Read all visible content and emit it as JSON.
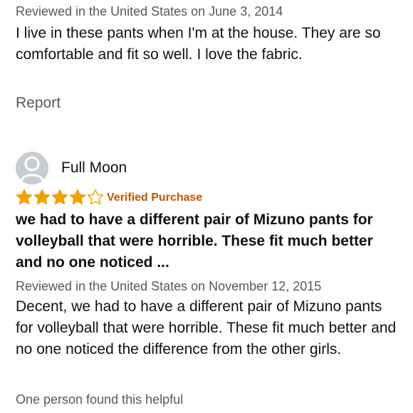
{
  "review1": {
    "meta": "Reviewed in the United States on June 3, 2014",
    "body": "I live in these pants when I'm at the house. They are so comfortable and fit so well. I love the fabric.",
    "report_label": "Report"
  },
  "review2": {
    "author": "Full Moon",
    "avatar_icon": "user-silhouette-icon",
    "rating": 4,
    "rating_max": 5,
    "star_color": "#f0a000",
    "verified_label": "Verified Purchase",
    "title": "we had to have a different pair of Mizuno pants for volleyball that were horrible. These fit much better and no one noticed ...",
    "meta": "Reviewed in the United States on November 12, 2015",
    "body": "Decent, we had to have a different pair of Mizuno pants for volleyball that were horrible. These fit much better and no one noticed the difference from the other girls.",
    "helpful_text": "One person found this helpful"
  },
  "colors": {
    "secondary_text": "#565959",
    "verified": "#c45500",
    "avatar_bg": "#c8cdd1"
  }
}
